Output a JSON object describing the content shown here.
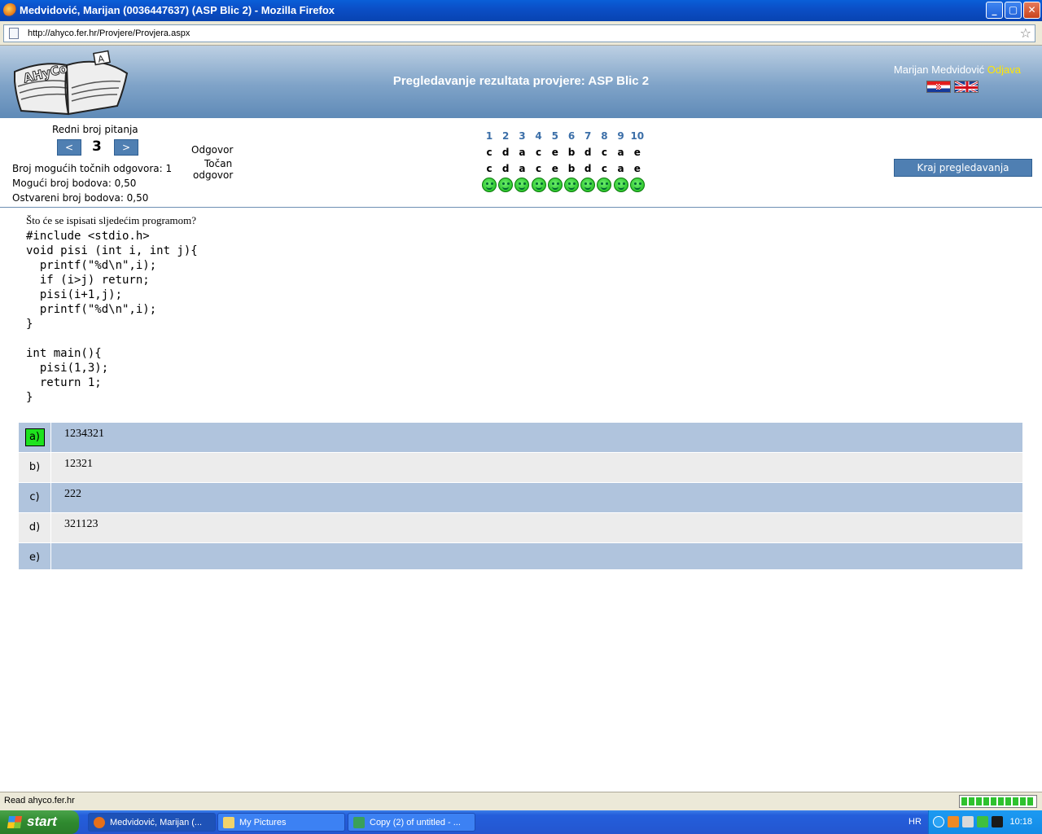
{
  "window": {
    "title": "Medvidović, Marijan (0036447637) (ASP Blic 2) - Mozilla Firefox",
    "url": "http://ahyco.fer.hr/Provjere/Provjera.aspx"
  },
  "header": {
    "logo_text": "AHyCo",
    "title": "Pregledavanje rezultata provjere: ASP Blic 2",
    "user_name": "Marijan Medvidović",
    "logout_label": "Odjava"
  },
  "info": {
    "question_number_label": "Redni broj pitanja",
    "prev_label": "<",
    "next_label": ">",
    "current_question": "3",
    "answer_label": "Odgovor",
    "correct_label_1": "Točan",
    "correct_label_2": "odgovor",
    "possible_correct": "Broj mogućih točnih odgovora: 1",
    "possible_points": "Mogući broj bodova: 0,50",
    "achieved_points": "Ostvareni broj bodova: 0,50",
    "end_button": "Kraj pregledavanja"
  },
  "grid": {
    "numbers": [
      "1",
      "2",
      "3",
      "4",
      "5",
      "6",
      "7",
      "8",
      "9",
      "10"
    ],
    "answers": [
      "c",
      "d",
      "a",
      "c",
      "e",
      "b",
      "d",
      "c",
      "a",
      "e"
    ],
    "correct": [
      "c",
      "d",
      "a",
      "c",
      "e",
      "b",
      "d",
      "c",
      "a",
      "e"
    ],
    "result_icon": "smiley-icon"
  },
  "question": {
    "text": "Što će se ispisati sljedećim programom?",
    "code": [
      "#include <stdio.h>",
      "void pisi (int i, int j){",
      "  printf(\"%d\\n\",i);",
      "  if (i>j) return;",
      "  pisi(i+1,j);",
      "  printf(\"%d\\n\",i);",
      "}",
      "",
      "int main(){",
      "  pisi(1,3);",
      "  return 1;",
      "}"
    ]
  },
  "answers": [
    {
      "letter": "a)",
      "text": "1234321",
      "correct": true
    },
    {
      "letter": "b)",
      "text": "12321",
      "correct": false
    },
    {
      "letter": "c)",
      "text": "222",
      "correct": false
    },
    {
      "letter": "d)",
      "text": "321123",
      "correct": false
    },
    {
      "letter": "e)",
      "text": "",
      "correct": false
    }
  ],
  "status": {
    "text": "Read ahyco.fer.hr",
    "progress": 1.0
  },
  "taskbar": {
    "start_label": "start",
    "tasks": [
      {
        "label": "Medvidović, Marijan (...",
        "icon": "firefox-icon",
        "active": true
      },
      {
        "label": "My Pictures",
        "icon": "folder-icon",
        "active": false
      },
      {
        "label": "Copy (2) of untitled - ...",
        "icon": "image-icon",
        "active": false
      }
    ],
    "language": "HR",
    "clock": "10:18"
  },
  "colors": {
    "accent": "#4f7fb2",
    "correct_highlight": "#1ee21e",
    "logout": "#ffe600",
    "row_blue": "#b0c4dd",
    "row_gray": "#ececec"
  }
}
